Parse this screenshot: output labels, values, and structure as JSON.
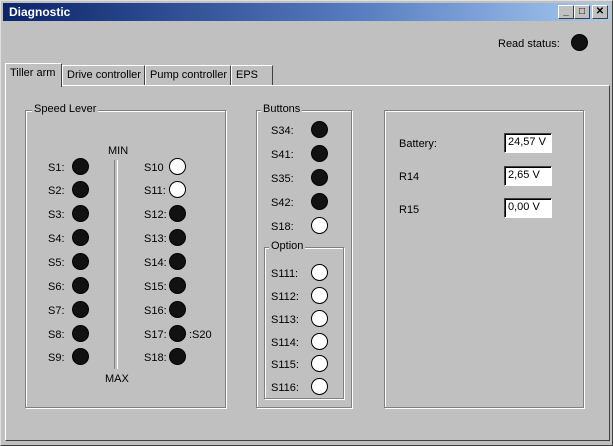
{
  "window": {
    "title": "Diagnostic",
    "controls": {
      "minimize": "_",
      "maximize": "□",
      "close": "✕"
    }
  },
  "read_status": {
    "label": "Read status:",
    "state": "on"
  },
  "tabs": [
    {
      "label": "Tiller arm",
      "active": true
    },
    {
      "label": "Drive controller",
      "active": false
    },
    {
      "label": "Pump controller",
      "active": false
    },
    {
      "label": "EPS",
      "active": false
    }
  ],
  "speed_lever": {
    "title": "Speed Lever",
    "min_label": "MIN",
    "max_label": "MAX",
    "left": [
      {
        "label": "S1:",
        "state": "on"
      },
      {
        "label": "S2:",
        "state": "on"
      },
      {
        "label": "S3:",
        "state": "on"
      },
      {
        "label": "S4:",
        "state": "on"
      },
      {
        "label": "S5:",
        "state": "on"
      },
      {
        "label": "S6:",
        "state": "on"
      },
      {
        "label": "S7:",
        "state": "on"
      },
      {
        "label": "S8:",
        "state": "on"
      },
      {
        "label": "S9:",
        "state": "on"
      }
    ],
    "right": [
      {
        "label": "S10",
        "state": "off"
      },
      {
        "label": "S11:",
        "state": "off"
      },
      {
        "label": "S12:",
        "state": "on"
      },
      {
        "label": "S13:",
        "state": "on"
      },
      {
        "label": "S14:",
        "state": "on"
      },
      {
        "label": "S15:",
        "state": "on"
      },
      {
        "label": "S16:",
        "state": "on"
      },
      {
        "label": "S17:",
        "state": "on",
        "suffix": ":S20"
      },
      {
        "label": "S18:",
        "state": "on"
      }
    ]
  },
  "buttons": {
    "title": "Buttons",
    "items": [
      {
        "label": "S34:",
        "state": "on"
      },
      {
        "label": "S41:",
        "state": "on"
      },
      {
        "label": "S35:",
        "state": "on"
      },
      {
        "label": "S42:",
        "state": "on"
      },
      {
        "label": "S18:",
        "state": "off"
      }
    ],
    "option": {
      "title": "Option",
      "items": [
        {
          "label": "S111:",
          "state": "off"
        },
        {
          "label": "S112:",
          "state": "off"
        },
        {
          "label": "S113:",
          "state": "off"
        },
        {
          "label": "S114:",
          "state": "off"
        },
        {
          "label": "S115:",
          "state": "off"
        },
        {
          "label": "S116:",
          "state": "off"
        }
      ]
    }
  },
  "measurements": [
    {
      "label": "Battery:",
      "value": "24,57 V"
    },
    {
      "label": "R14",
      "value": "2,65 V"
    },
    {
      "label": "R15",
      "value": "0,00 V"
    }
  ],
  "colors": {
    "led_on": "#111111",
    "led_off": "#ffffff",
    "title_bar": "#0a246a"
  }
}
